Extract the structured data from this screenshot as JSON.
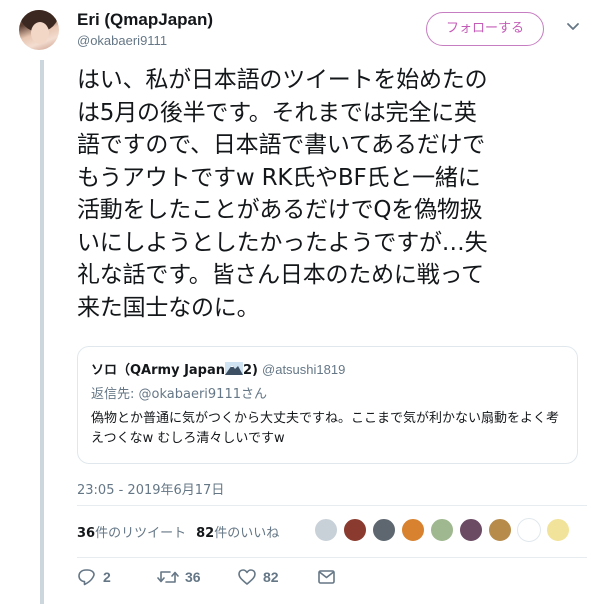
{
  "author": {
    "display_name": "Eri (QmapJapan)",
    "handle": "@okabaeri9111"
  },
  "follow_button_label": "フォローする",
  "tweet_text": "はい、私が日本語のツイートを始めたの\nは5月の後半です。それまでは完全に英\n語ですので、日本語で書いてあるだけで\nもうアウトですw  RK氏やBF氏と一緒に\n活動をしたことがあるだけでQを偽物扱\nいにしようとしたかったようですが…失\n礼な話です。皆さん日本のために戦って\n来た国士なのに。",
  "quoted_tweet": {
    "display_name": "ソロ（QArmy Japan",
    "name_suffix": "2)",
    "handle": "@atsushi1819",
    "reply_prefix": "返信先: ",
    "reply_to": "@okabaeri9111さん",
    "text": "偽物とか普通に気がつくから大丈夫ですね。ここまで気が利かない扇動をよく考えつくなw むしろ清々しいですw"
  },
  "timestamp": "23:05 - 2019年6月17日",
  "stats": {
    "retweet_count": "36",
    "retweet_label": "件のリツイート",
    "like_count": "82",
    "like_label": "件のいいね"
  },
  "actions": {
    "reply_count": "2",
    "retweet_count": "36",
    "like_count": "82"
  },
  "liker_colors": [
    "#c9d1d8",
    "#8a3a2e",
    "#5e6770",
    "#d8822f",
    "#9fb88f",
    "#6b4a63",
    "#b78b4a",
    "#ffffff",
    "#f2e39a"
  ],
  "colors": {
    "follow_accent": "#c45cb7",
    "thread_line": "#ccd6dd",
    "secondary_text": "#657786"
  }
}
